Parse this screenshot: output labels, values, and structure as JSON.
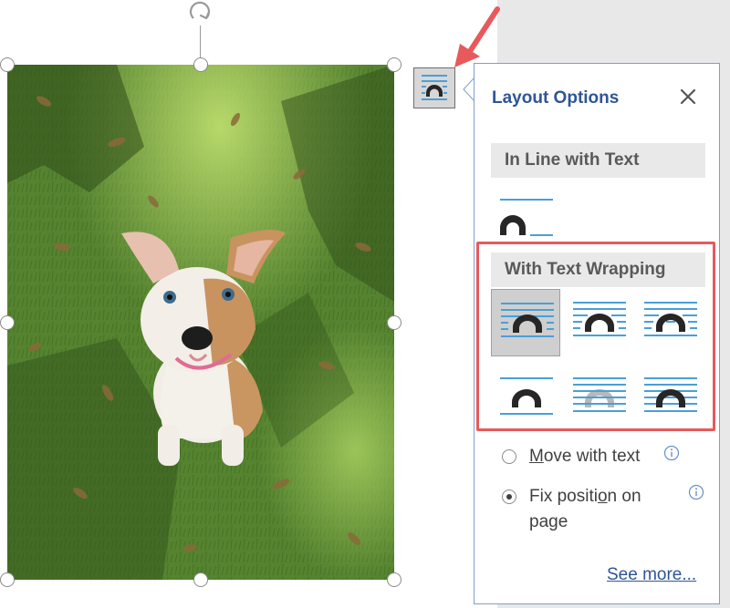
{
  "layout_options": {
    "title": "Layout Options",
    "inline_section": {
      "heading": "In Line with Text",
      "options": [
        {
          "icon": "in-line-with-text-icon",
          "selected": false
        }
      ]
    },
    "wrapping_section": {
      "heading": "With Text Wrapping",
      "options": [
        {
          "icon": "square-wrap-icon",
          "selected": true
        },
        {
          "icon": "tight-wrap-icon",
          "selected": false
        },
        {
          "icon": "through-wrap-icon",
          "selected": false
        },
        {
          "icon": "top-and-bottom-wrap-icon",
          "selected": false
        },
        {
          "icon": "behind-text-icon",
          "selected": false
        },
        {
          "icon": "in-front-of-text-icon",
          "selected": false
        }
      ]
    },
    "move_with_text": {
      "pre": "",
      "underline": "M",
      "post": "ove with text",
      "checked": false
    },
    "fix_position": {
      "line1_pre": "Fix positi",
      "line1_underline": "o",
      "line1_post": "n on",
      "line2": "page",
      "checked": true
    },
    "see_more": "See more..."
  },
  "colors": {
    "accent": "#2f5597",
    "highlight_box": "#e8595c",
    "arrow": "#e8595c",
    "icon_line": "#4a9fd8",
    "icon_shape": "#262626"
  }
}
